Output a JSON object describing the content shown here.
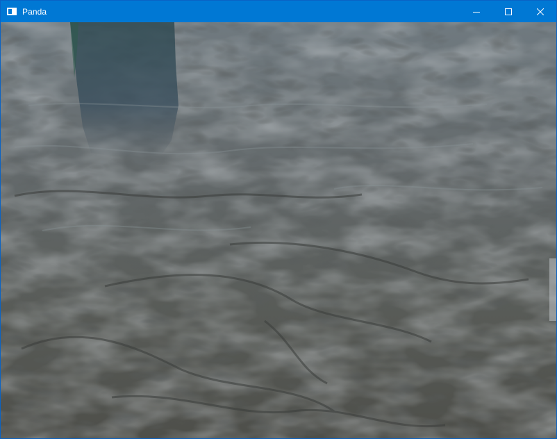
{
  "window": {
    "title": "Panda",
    "icon": "app-window-icon",
    "controls": {
      "minimize": "minimize-icon",
      "maximize": "maximize-icon",
      "close": "close-icon"
    },
    "accent_color": "#0078d4"
  },
  "scene": {
    "description_icon": "water-surface",
    "water_color_near": "#5a5c58",
    "water_color_far": "#6c7478",
    "reflection_color": "#3f5260"
  }
}
